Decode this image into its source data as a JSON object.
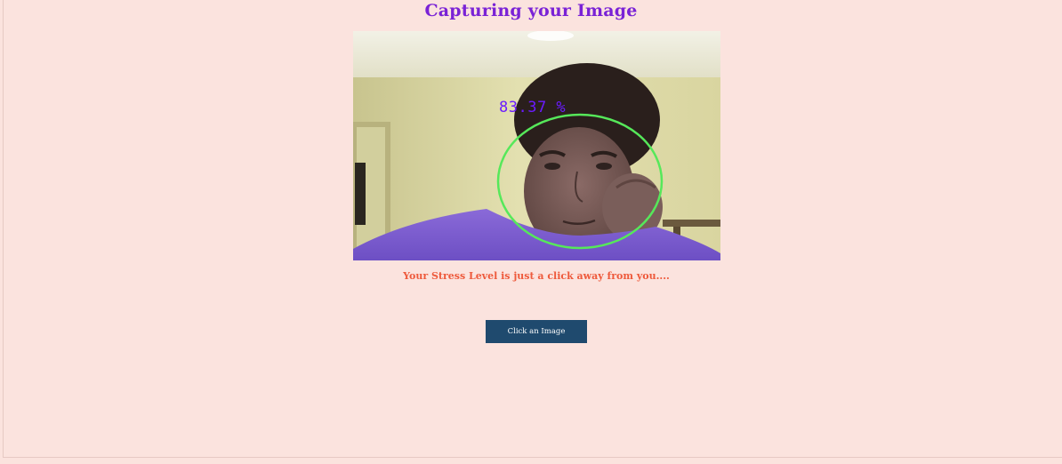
{
  "header": {
    "title": "Capturing your Image"
  },
  "webcam": {
    "confidence_label": "83.37 %",
    "face_box_color": "#56e85a",
    "label_color": "#6a1bff"
  },
  "main": {
    "subtitle": "Your Stress Level is just a click away from you....",
    "button_label": "Click an Image"
  },
  "colors": {
    "background": "#fbe3de",
    "title": "#7a22d6",
    "subtitle": "#ee5a3c",
    "button": "#1f4a6e"
  }
}
